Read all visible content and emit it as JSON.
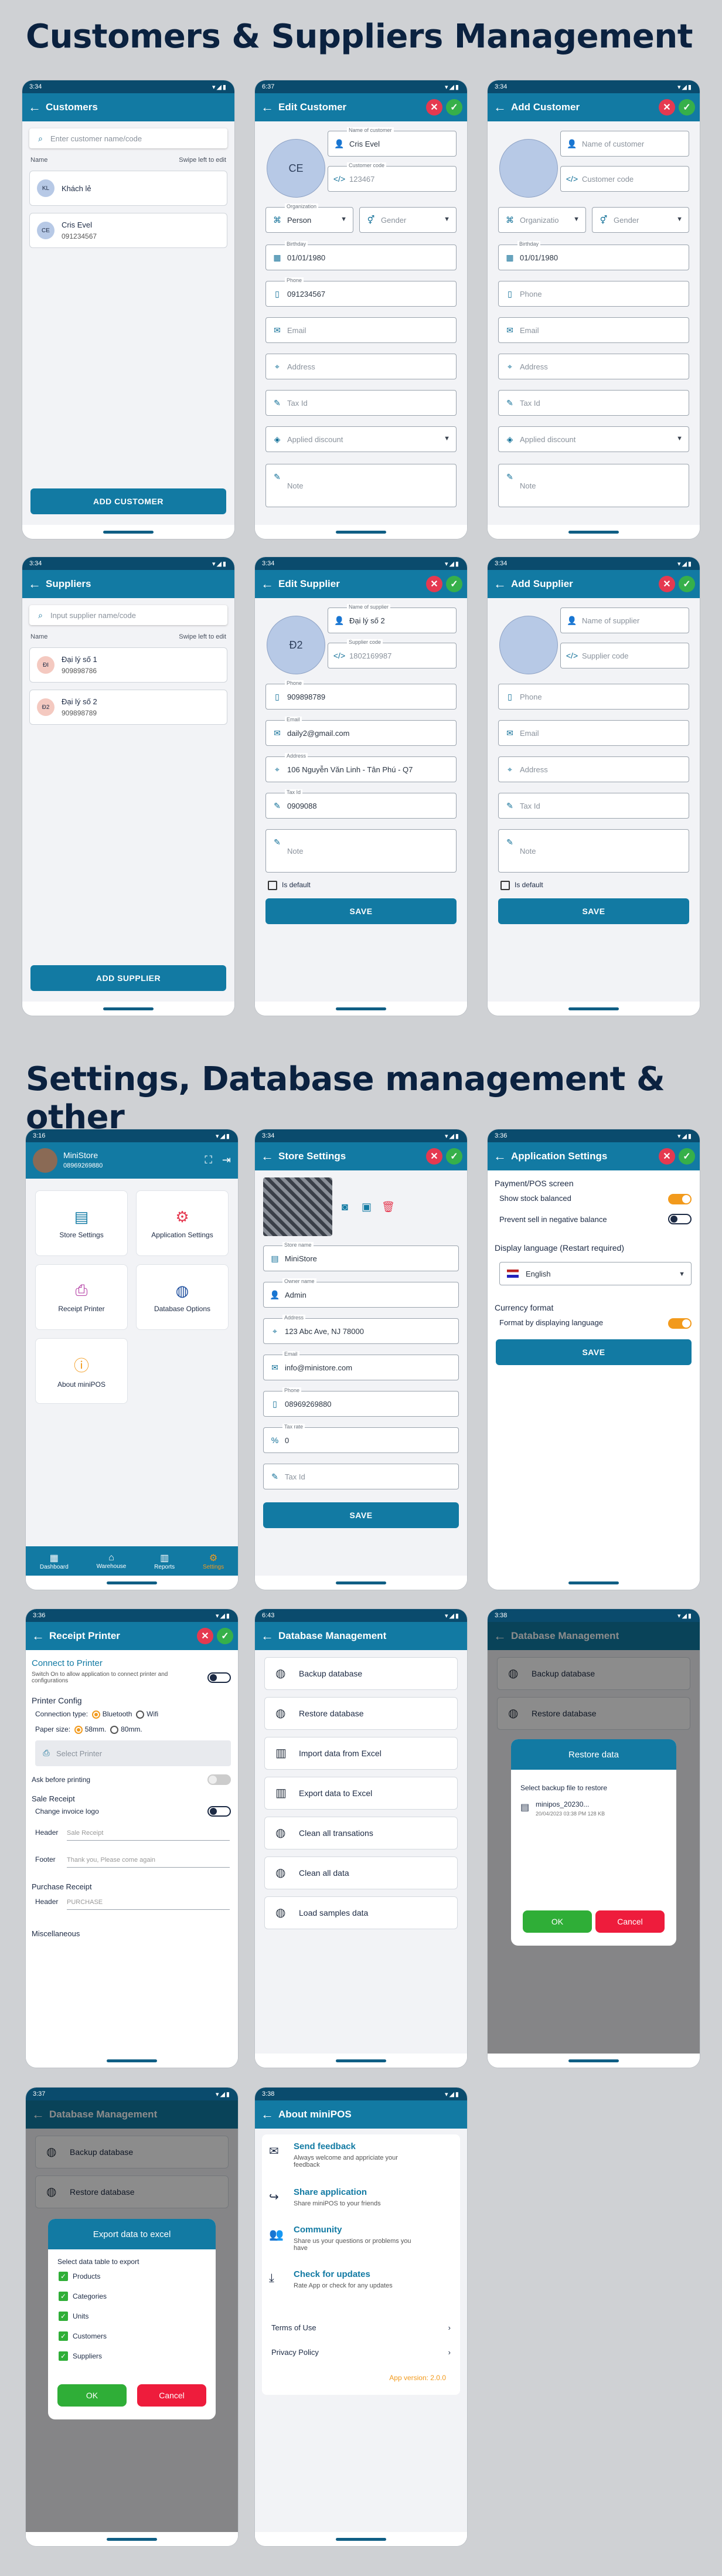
{
  "titles": {
    "s1": "Customers & Suppliers Management",
    "s2": "Settings, Database management & other"
  },
  "status": {
    "t334": "3:34",
    "t337": "6:37",
    "t316": "3:16",
    "t336": "3:36",
    "t643": "6:43",
    "t338": "3:38",
    "t3337": "3:37",
    "icons": "▾◢▮"
  },
  "customers": {
    "title": "Customers",
    "search_ph": "Enter customer name/code",
    "col": "Name",
    "hint": "Swipe left to edit",
    "rows": [
      {
        "initials": "KL",
        "name": "Khách lẻ",
        "phone": ""
      },
      {
        "initials": "CE",
        "name": "Cris Evel",
        "phone": "091234567"
      }
    ],
    "add": "ADD CUSTOMER"
  },
  "edit_customer": {
    "title": "Edit Customer",
    "initials": "CE",
    "name_lab": "Name of customer",
    "name": "Cris Evel",
    "code_lab": "Customer code",
    "code": "123467",
    "org_lab": "Organization",
    "org": "Person",
    "gender": "Gender",
    "bday_lab": "Birthday",
    "bday": "01/01/1980",
    "phone_lab": "Phone",
    "phone": "091234567",
    "email": "Email",
    "address": "Address",
    "tax": "Tax Id",
    "discount": "Applied discount",
    "note": "Note"
  },
  "add_customer": {
    "title": "Add Customer",
    "name": "Name of customer",
    "code": "Customer code",
    "org": "Organizatio",
    "gender": "Gender",
    "bday_lab": "Birthday",
    "bday": "01/01/1980",
    "phone": "Phone",
    "email": "Email",
    "address": "Address",
    "tax": "Tax Id",
    "discount": "Applied discount",
    "note": "Note"
  },
  "suppliers": {
    "title": "Suppliers",
    "search_ph": "Input supplier name/code",
    "col": "Name",
    "hint": "Swipe left to edit",
    "rows": [
      {
        "initials": "ĐI",
        "name": "Đại lý số 1",
        "phone": "909898786"
      },
      {
        "initials": "Đ2",
        "name": "Đại lý số 2",
        "phone": "909898789"
      }
    ],
    "add": "ADD SUPPLIER"
  },
  "edit_supplier": {
    "title": "Edit Supplier",
    "initials": "Đ2",
    "name_lab": "Name of supplier",
    "name": "Đại lý số 2",
    "code_lab": "Supplier code",
    "code": "1802169987",
    "phone_lab": "Phone",
    "phone": "909898789",
    "email_lab": "Email",
    "email": "daily2@gmail.com",
    "addr_lab": "Address",
    "addr": "106 Nguyễn Văn Linh - Tân Phú - Q7",
    "tax_lab": "Tax Id",
    "tax": "0909088",
    "note": "Note",
    "default": "Is default",
    "save": "SAVE"
  },
  "add_supplier": {
    "title": "Add Supplier",
    "name": "Name of supplier",
    "code": "Supplier code",
    "phone": "Phone",
    "email": "Email",
    "address": "Address",
    "tax": "Tax Id",
    "note": "Note",
    "default": "Is default",
    "save": "SAVE"
  },
  "home": {
    "store": "MiniStore",
    "phone": "08969269880",
    "tiles": [
      "Store Settings",
      "Application Settings",
      "Receipt Printer",
      "Database Options",
      "About miniPOS"
    ],
    "nav": [
      "Dashboard",
      "Warehouse",
      "Reports",
      "Settings"
    ]
  },
  "store_settings": {
    "title": "Store Settings",
    "store_lab": "Store name",
    "store": "MiniStore",
    "owner_lab": "Owner name",
    "owner": "Admin",
    "addr_lab": "Address",
    "addr": "123 Abc Ave, NJ 78000",
    "email_lab": "Email",
    "email": "info@ministore.com",
    "phone_lab": "Phone",
    "phone": "08969269880",
    "taxrate_lab": "Tax rate",
    "taxrate": "0",
    "taxid": "Tax Id",
    "save": "SAVE"
  },
  "app_settings": {
    "title": "Application Settings",
    "s1": "Payment/POS screen",
    "o1": "Show stock balanced",
    "o2": "Prevent sell in negative balance",
    "s2": "Display language (Restart required)",
    "lang": "English",
    "s3": "Currency format",
    "o3": "Format by displaying language",
    "save": "SAVE"
  },
  "receipt": {
    "title": "Receipt Printer",
    "connect": "Connect to Printer",
    "connect_desc": "Switch On to allow application to connect printer and configurations",
    "config": "Printer Config",
    "conn_type": "Connection type:",
    "bt": "Bluetooth",
    "wifi": "Wifi",
    "paper": "Paper size:",
    "p58": "58mm.",
    "p80": "80mm.",
    "select": "Select Printer",
    "ask": "Ask before printing",
    "sale": "Sale Receipt",
    "logo": "Change invoice logo",
    "header": "Header",
    "header_ph": "Sale Receipt",
    "footer": "Footer",
    "footer_ph": "Thank you, Please come again",
    "purchase": "Purchase Receipt",
    "header2": "Header",
    "header2_ph": "PURCHASE",
    "misc": "Miscellaneous"
  },
  "db": {
    "title": "Database Management",
    "items": [
      "Backup database",
      "Restore database",
      "Import data from Excel",
      "Export data to Excel",
      "Clean all transations",
      "Clean all data",
      "Load samples data"
    ]
  },
  "restore": {
    "title": "Restore data",
    "select": "Select backup file to restore",
    "file": "minipos_20230...",
    "date": "20/04/2023 03:38 PM 128 KB",
    "ok": "OK",
    "cancel": "Cancel"
  },
  "export": {
    "title": "Export data to excel",
    "select": "Select data table to export",
    "items": [
      "Products",
      "Categories",
      "Units",
      "Customers",
      "Suppliers"
    ],
    "ok": "OK",
    "cancel": "Cancel"
  },
  "about": {
    "title": "About miniPOS",
    "items": [
      {
        "t": "Send feedback",
        "d": "Always welcome and appriciate your feedback"
      },
      {
        "t": "Share application",
        "d": "Share miniPOS to your friends"
      },
      {
        "t": "Community",
        "d": "Share us your questions or problems you have"
      },
      {
        "t": "Check for updates",
        "d": "Rate App or check for any updates"
      }
    ],
    "terms": "Terms of Use",
    "privacy": "Privacy Policy",
    "version": "App version: 2.0.0"
  }
}
